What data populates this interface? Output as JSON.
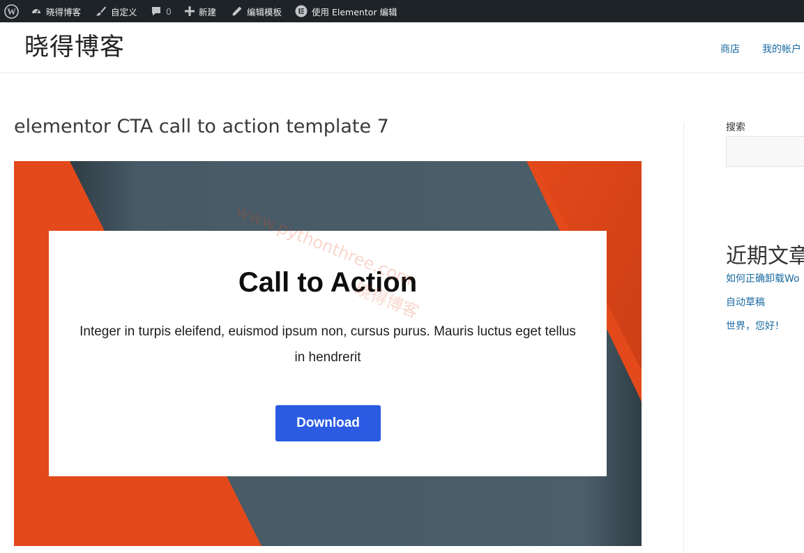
{
  "admin_bar": {
    "items": [
      {
        "label": ""
      },
      {
        "label": "晓得博客"
      },
      {
        "label": "自定义"
      },
      {
        "label": "0"
      },
      {
        "label": "新建"
      },
      {
        "label": "编辑模板"
      },
      {
        "label": "使用 Elementor 编辑"
      }
    ]
  },
  "header": {
    "site_title": "晓得博客",
    "nav": [
      "商店",
      "我的帐户"
    ]
  },
  "main": {
    "post_title": "elementor CTA call to action template 7",
    "cta": {
      "heading": "Call to Action",
      "description": "Integer in turpis eleifend, euismod ipsum non, cursus purus. Mauris luctus eget tellus in hendrerit",
      "button_label": "Download",
      "colors": {
        "orange": "#e4491b",
        "slate": "#475a66",
        "button": "#2b5be3"
      }
    },
    "watermark": {
      "line1": "www.pythonthree.com",
      "line2": "晓得博客"
    }
  },
  "sidebar": {
    "search_label": "搜索",
    "search_value": "",
    "recent_heading": "近期文章",
    "recent_posts": [
      "如何正确卸载Wo",
      "自动草稿",
      "世界，您好！"
    ]
  }
}
